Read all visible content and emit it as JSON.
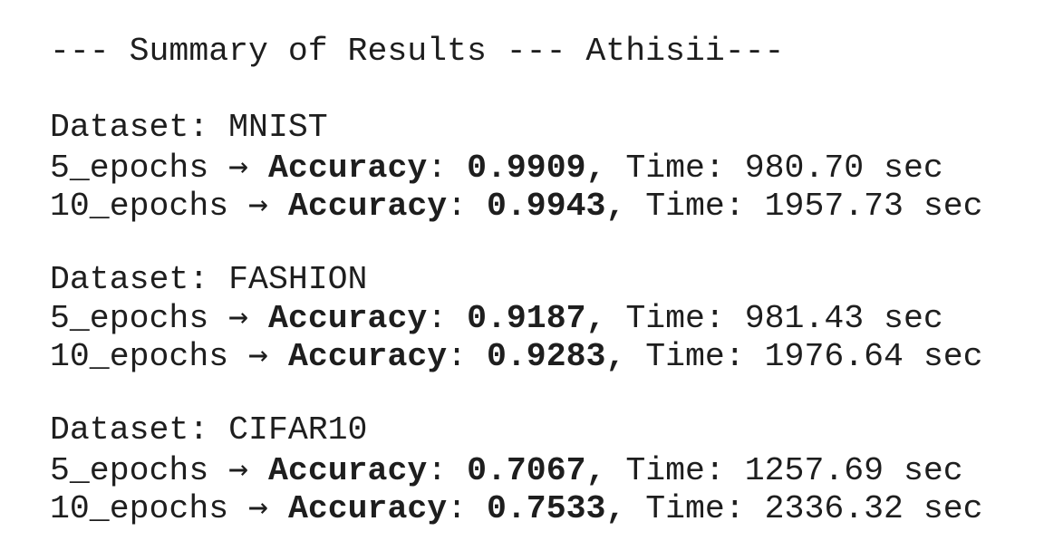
{
  "title": "--- Summary of Results --- Athisii---",
  "dataset_prefix": "Dataset: ",
  "arrow": "→",
  "accuracy_label": "Accuracy",
  "time_label": "Time: ",
  "time_unit": " sec",
  "datasets": [
    {
      "name": "MNIST",
      "runs": [
        {
          "epochs": "5_epochs",
          "accuracy": "0.9909",
          "time": "980.70"
        },
        {
          "epochs": "10_epochs",
          "accuracy": "0.9943",
          "time": "1957.73"
        }
      ]
    },
    {
      "name": "FASHION",
      "runs": [
        {
          "epochs": "5_epochs",
          "accuracy": "0.9187",
          "time": "981.43"
        },
        {
          "epochs": "10_epochs",
          "accuracy": "0.9283",
          "time": "1976.64"
        }
      ]
    },
    {
      "name": "CIFAR10",
      "runs": [
        {
          "epochs": "5_epochs",
          "accuracy": "0.7067",
          "time": "1257.69"
        },
        {
          "epochs": "10_epochs",
          "accuracy": "0.7533",
          "time": "2336.32"
        }
      ]
    }
  ]
}
